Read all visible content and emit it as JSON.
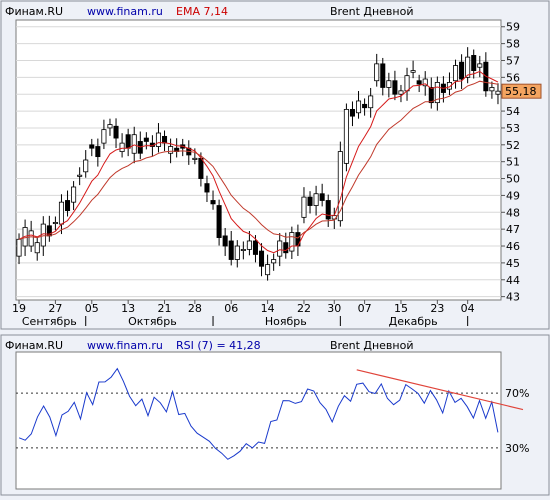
{
  "chart_data": [
    {
      "type": "candlestick",
      "header": {
        "site": "Финам.RU",
        "url": "www.finam.ru",
        "indicator": "EMA 7,14",
        "instrument": "Brent Дневной"
      },
      "y_ticks": [
        43,
        44,
        45,
        46,
        47,
        48,
        49,
        50,
        51,
        52,
        53,
        54,
        55,
        56,
        57,
        58,
        59
      ],
      "ylim": [
        42.8,
        59.4
      ],
      "x_ticks": [
        {
          "label": "19",
          "idx": 0
        },
        {
          "label": "27",
          "idx": 6
        },
        {
          "label": "05",
          "idx": 12
        },
        {
          "label": "13",
          "idx": 18
        },
        {
          "label": "21",
          "idx": 24
        },
        {
          "label": "28",
          "idx": 29
        },
        {
          "label": "06",
          "idx": 35
        },
        {
          "label": "14",
          "idx": 41
        },
        {
          "label": "22",
          "idx": 47
        },
        {
          "label": "30",
          "idx": 52
        },
        {
          "label": "07",
          "idx": 57
        },
        {
          "label": "15",
          "idx": 63
        },
        {
          "label": "23",
          "idx": 69
        },
        {
          "label": "04",
          "idx": 74
        }
      ],
      "months": [
        {
          "label": "Сентябрь",
          "idx": 5
        },
        {
          "label": "Октябрь",
          "idx": 22
        },
        {
          "label": "Ноябрь",
          "idx": 44
        },
        {
          "label": "Декабрь",
          "idx": 65
        }
      ],
      "month_separators": [
        11,
        32,
        53,
        74
      ],
      "last_price_label": "55,18",
      "accent_color": "#f4a460",
      "closes": [
        46.4,
        47.1,
        46.9,
        46.2,
        47.3,
        46.6,
        47.4,
        48.6,
        48.1,
        49.5,
        50.2,
        51.1,
        51.8,
        51.3,
        52.9,
        53.2,
        52.4,
        52.1,
        51.8,
        52.6,
        51.5,
        52.2,
        51.9,
        52.7,
        52.1,
        51.9,
        51.6,
        51.8,
        51.4,
        51.2,
        50.0,
        49.2,
        48.5,
        46.5,
        46.0,
        45.2,
        46.0,
        45.8,
        46.3,
        45.5,
        44.8,
        44.9,
        45.2,
        46.3,
        45.6,
        46.8,
        46.0,
        48.9,
        48.4,
        49.1,
        48.7,
        47.6,
        47.8,
        51.6,
        54.1,
        53.7,
        54.6,
        54.2,
        54.9,
        56.8,
        55.4,
        55.8,
        55.0,
        55.2,
        56.1,
        56.4,
        55.6,
        55.9,
        54.5,
        55.7,
        55.1,
        55.7,
        56.7,
        55.9,
        57.2,
        56.4,
        56.8,
        55.2,
        55.4,
        55.18
      ],
      "opens": [
        45.4,
        46.0,
        46.0,
        45.6,
        46.0,
        47.2,
        47.4,
        47.3,
        48.7,
        48.6,
        50.2,
        50.4,
        52.0,
        51.9,
        52.1,
        53.0,
        53.1,
        51.6,
        52.6,
        51.5,
        52.2,
        52.4,
        52.1,
        51.9,
        52.5,
        51.5,
        51.8,
        52.0,
        51.8,
        51.2,
        51.2,
        49.7,
        48.7,
        48.4,
        46.6,
        46.3,
        45.2,
        45.8,
        45.8,
        46.3,
        45.7,
        44.3,
        45.0,
        45.4,
        46.2,
        45.7,
        46.8,
        47.7,
        48.9,
        48.4,
        49.1,
        48.7,
        47.6,
        47.5,
        50.9,
        54.1,
        53.9,
        54.4,
        54.2,
        55.8,
        56.8,
        55.4,
        55.8,
        55.0,
        55.2,
        56.3,
        55.8,
        55.5,
        55.4,
        54.5,
        55.6,
        55.3,
        55.8,
        56.9,
        56.0,
        57.3,
        56.6,
        56.9,
        55.2,
        55.0
      ],
      "rsi_header": {
        "site": "Финам.RU",
        "url": "www.finam.ru",
        "indicator": "RSI (7) = 41,28",
        "instrument": "Brent Дневной"
      },
      "rsi_ticks": [
        {
          "label": "70%",
          "value": 70
        },
        {
          "label": "30%",
          "value": 30
        }
      ],
      "rsi_values": [
        37.4,
        35.6,
        40.2,
        52.6,
        60.6,
        52.5,
        39.0,
        54.0,
        56.7,
        63.3,
        51.1,
        70.3,
        61.6,
        78.1,
        78.2,
        81.7,
        87.9,
        78.6,
        67.6,
        60.8,
        65.6,
        53.5,
        66.9,
        62.9,
        56.3,
        71.1,
        54.4,
        55.2,
        45.9,
        40.7,
        37.8,
        34.8,
        29.6,
        26.1,
        21.7,
        24.2,
        27.6,
        33.1,
        30.0,
        34.3,
        33.3,
        49.3,
        50.4,
        64.5,
        64.4,
        62.5,
        63.8,
        73.0,
        71.5,
        63.1,
        58.1,
        49.0,
        60.4,
        68.1,
        64.0,
        76.4,
        77.3,
        71.0,
        69.7,
        76.7,
        66.1,
        61.5,
        64.8,
        76.2,
        73.1,
        69.7,
        62.6,
        71.9,
        65.1,
        55.5,
        71.6,
        63.2,
        66.2,
        60.1,
        51.8,
        64.5,
        51.6,
        63.6,
        41.28
      ]
    }
  ]
}
